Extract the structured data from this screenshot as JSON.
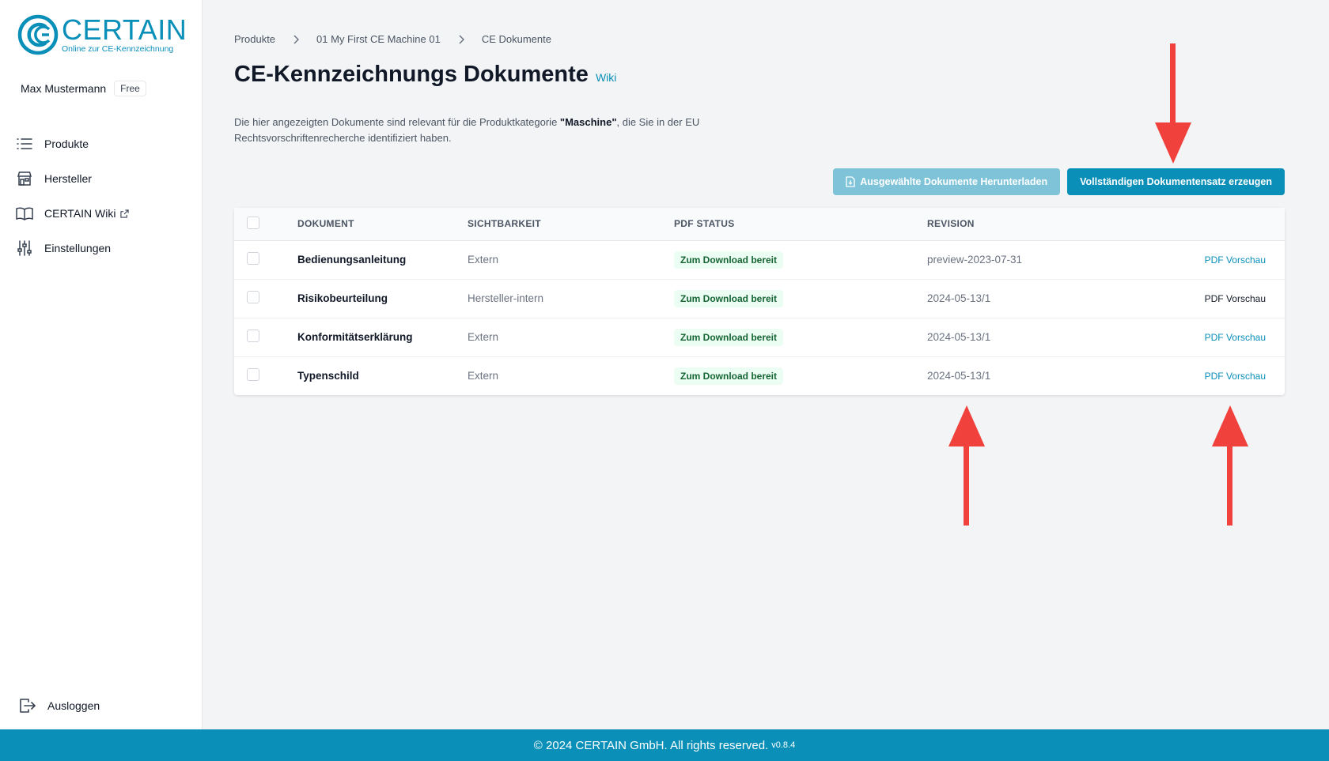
{
  "brand": {
    "title": "CERTAIN",
    "subtitle": "Online zur CE-Kennzeichnung",
    "color": "#0a8fb8"
  },
  "user": {
    "name": "Max Mustermann",
    "plan": "Free"
  },
  "nav": {
    "items": [
      {
        "label": "Produkte",
        "icon": "list-icon"
      },
      {
        "label": "Hersteller",
        "icon": "store-icon"
      },
      {
        "label": "CERTAIN Wiki",
        "icon": "book-icon"
      },
      {
        "label": "Einstellungen",
        "icon": "sliders-icon"
      }
    ],
    "logout": "Ausloggen"
  },
  "breadcrumb": {
    "items": [
      "Produkte",
      "01 My First CE Machine 01",
      "CE Dokumente"
    ]
  },
  "page": {
    "title": "CE-Kennzeichnungs Dokumente",
    "wiki_link": "Wiki",
    "desc_before": "Die hier angezeigten Dokumente sind relevant für die Produktkategorie ",
    "desc_bold": "\"Maschine\"",
    "desc_after": ", die Sie in der EU Rechtsvorschriftenrecherche identifiziert haben."
  },
  "buttons": {
    "download_selected": "Ausgewählte Dokumente Herunterladen",
    "generate_full": "Vollständigen Dokumentensatz erzeugen"
  },
  "table": {
    "headers": {
      "document": "Dokument",
      "visibility": "Sichtbarkeit",
      "pdf_status": "PDF Status",
      "revision": "Revision"
    },
    "rows": [
      {
        "document": "Bedienungsanleitung",
        "visibility": "Extern",
        "status": "Zum Download bereit",
        "revision": "preview-2023-07-31",
        "action": "PDF Vorschau"
      },
      {
        "document": "Risikobeurteilung",
        "visibility": "Hersteller-intern",
        "status": "Zum Download bereit",
        "revision": "2024-05-13/1",
        "action": "PDF Vorschau"
      },
      {
        "document": "Konformitätserklärung",
        "visibility": "Extern",
        "status": "Zum Download bereit",
        "revision": "2024-05-13/1",
        "action": "PDF Vorschau"
      },
      {
        "document": "Typenschild",
        "visibility": "Extern",
        "status": "Zum Download bereit",
        "revision": "2024-05-13/1",
        "action": "PDF Vorschau"
      }
    ]
  },
  "footer": {
    "copyright": "© 2024 CERTAIN GmbH. All rights reserved.",
    "version": "v0.8.4"
  },
  "colors": {
    "accent": "#0a8fb8",
    "arrow": "#f0413c",
    "status_bg": "#ecfdf3",
    "status_text": "#166534"
  }
}
